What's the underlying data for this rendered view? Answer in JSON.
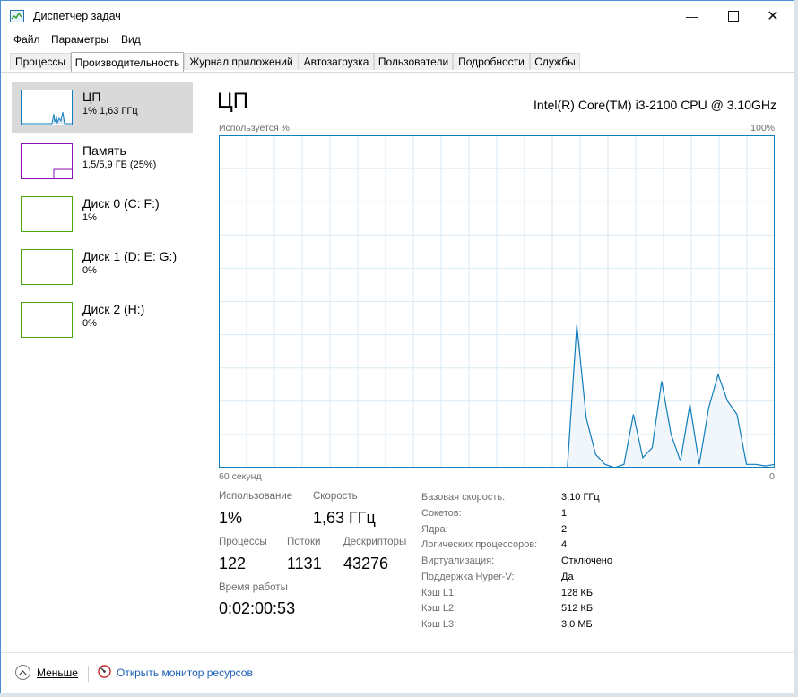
{
  "window": {
    "title": "Диспетчер задач"
  },
  "menu": [
    "Файл",
    "Параметры",
    "Вид"
  ],
  "tabs": [
    "Процессы",
    "Производительность",
    "Журнал приложений",
    "Автозагрузка",
    "Пользователи",
    "Подробности",
    "Службы"
  ],
  "active_tab": 1,
  "sidebar": [
    {
      "title": "ЦП",
      "sub": "1% 1,63 ГГц",
      "color": "#117dbb",
      "selected": true
    },
    {
      "title": "Память",
      "sub": "1,5/5,9 ГБ (25%)",
      "color": "#8b12ae",
      "selected": false
    },
    {
      "title": "Диск 0 (C: F:)",
      "sub": "1%",
      "color": "#4da60c",
      "selected": false
    },
    {
      "title": "Диск 1 (D: E: G:)",
      "sub": "0%",
      "color": "#4da60c",
      "selected": false
    },
    {
      "title": "Диск 2 (H:)",
      "sub": "0%",
      "color": "#4da60c",
      "selected": false
    }
  ],
  "main": {
    "title": "ЦП",
    "model": "Intel(R) Core(TM) i3-2100 CPU @ 3.10GHz",
    "chart_top_left": "Используется %",
    "chart_top_right": "100%",
    "chart_bottom_left": "60 секунд",
    "chart_bottom_right": "0"
  },
  "stats": {
    "usage_label": "Использование",
    "usage_value": "1%",
    "speed_label": "Скорость",
    "speed_value": "1,63 ГГц",
    "processes_label": "Процессы",
    "processes_value": "122",
    "threads_label": "Потоки",
    "threads_value": "1131",
    "handles_label": "Дескрипторы",
    "handles_value": "43276",
    "uptime_label": "Время работы",
    "uptime_value": "0:02:00:53"
  },
  "info": [
    {
      "label": "Базовая скорость:",
      "value": "3,10 ГГц"
    },
    {
      "label": "Сокетов:",
      "value": "1"
    },
    {
      "label": "Ядра:",
      "value": "2"
    },
    {
      "label": "Логических процессоров:",
      "value": "4"
    },
    {
      "label": "Виртуализация:",
      "value": "Отключено"
    },
    {
      "label": "Поддержка Hyper-V:",
      "value": "Да"
    },
    {
      "label": "Кэш L1:",
      "value": "128 КБ"
    },
    {
      "label": "Кэш L2:",
      "value": "512 КБ"
    },
    {
      "label": "Кэш L3:",
      "value": "3,0 МБ"
    }
  ],
  "footer": {
    "less_label": "Меньше",
    "monitor_label": "Открыть монитор ресурсов"
  },
  "colors": {
    "cpu": "#117dbb",
    "cpu_fill": "#f1f6fa",
    "grid": "#d9eaf4"
  },
  "chart_data": {
    "type": "area",
    "x_range": [
      60,
      0
    ],
    "ylim": [
      0,
      100
    ],
    "grid": true,
    "series": [
      {
        "values": [
          0,
          0,
          0,
          0,
          0,
          0,
          0,
          0,
          0,
          0,
          0,
          0,
          0,
          0,
          0,
          0,
          0,
          0,
          0,
          0,
          0,
          0,
          0,
          0,
          0,
          0,
          0,
          0,
          0,
          0,
          0,
          0,
          0,
          0,
          0,
          0,
          0,
          0,
          43,
          15,
          4,
          1,
          0,
          1,
          16,
          3,
          6,
          26,
          10,
          2,
          19,
          1,
          18,
          28,
          20,
          16,
          1,
          1,
          0.5,
          1
        ]
      }
    ]
  }
}
